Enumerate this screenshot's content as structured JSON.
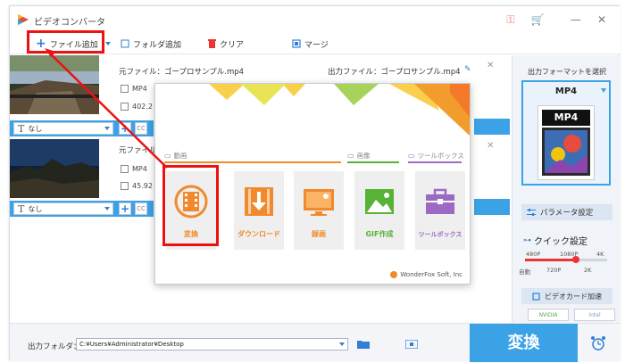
{
  "app": {
    "title": "ビデオコンバータ"
  },
  "toolbar": {
    "add_file": "ファイル追加",
    "add_folder": "フォルダ追加",
    "clear": "クリア",
    "merge": "マージ"
  },
  "files": [
    {
      "source_label": "元ファイル：",
      "source_name": "ゴープロサンプル.mp4",
      "format": "MP4",
      "size": "402.2",
      "output_label": "出力ファイル：",
      "output_name": "ゴープロサンプル.mp4",
      "subtitle": "なし"
    },
    {
      "source_label": "元ファイル",
      "source_name": "",
      "format": "MP4",
      "size": "45.92",
      "subtitle": "なし"
    }
  ],
  "popup": {
    "sections": {
      "video": "動画",
      "image": "画像",
      "toolbox": "ツールボックス"
    },
    "tiles": [
      {
        "label": "変換",
        "color": "#f08a2c"
      },
      {
        "label": "ダウンロード",
        "color": "#f08a2c"
      },
      {
        "label": "録画",
        "color": "#f08a2c"
      },
      {
        "label": "GIF作成",
        "color": "#58b236"
      },
      {
        "label": "ツールボックス",
        "color": "#9b6bc4"
      }
    ],
    "footer": "WonderFox Soft, Inc"
  },
  "right_panel": {
    "title": "出力フォーマットを選択",
    "format": "MP4",
    "format_card": "MP4",
    "param_button": "パラメータ設定",
    "quick_setting": "クイック設定",
    "ticks_top": [
      "480P",
      "1080P",
      "4K"
    ],
    "ticks_bottom": [
      "自動",
      "720P",
      "2K"
    ],
    "quality_level": 0.62,
    "gpu_button": "ビデオカード加速",
    "chips": [
      "NVIDIA",
      "Intel"
    ]
  },
  "bottom": {
    "output_label": "出力フォルダ：",
    "output_path": "C:¥Users¥Administrator¥Desktop",
    "convert": "変換"
  },
  "colors": {
    "accent": "#3ba2e6",
    "highlight": "#ee1111",
    "orange": "#f08a2c",
    "green": "#58b236",
    "purple": "#9b6bc4"
  }
}
